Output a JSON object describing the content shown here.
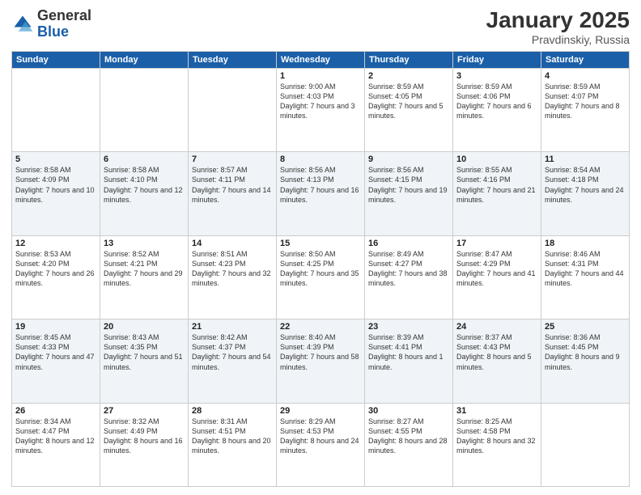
{
  "logo": {
    "general": "General",
    "blue": "Blue"
  },
  "header": {
    "title": "January 2025",
    "subtitle": "Pravdinskiy, Russia"
  },
  "weekdays": [
    "Sunday",
    "Monday",
    "Tuesday",
    "Wednesday",
    "Thursday",
    "Friday",
    "Saturday"
  ],
  "weeks": [
    [
      {
        "day": "",
        "info": ""
      },
      {
        "day": "",
        "info": ""
      },
      {
        "day": "",
        "info": ""
      },
      {
        "day": "1",
        "info": "Sunrise: 9:00 AM\nSunset: 4:03 PM\nDaylight: 7 hours\nand 3 minutes."
      },
      {
        "day": "2",
        "info": "Sunrise: 8:59 AM\nSunset: 4:05 PM\nDaylight: 7 hours\nand 5 minutes."
      },
      {
        "day": "3",
        "info": "Sunrise: 8:59 AM\nSunset: 4:06 PM\nDaylight: 7 hours\nand 6 minutes."
      },
      {
        "day": "4",
        "info": "Sunrise: 8:59 AM\nSunset: 4:07 PM\nDaylight: 7 hours\nand 8 minutes."
      }
    ],
    [
      {
        "day": "5",
        "info": "Sunrise: 8:58 AM\nSunset: 4:09 PM\nDaylight: 7 hours\nand 10 minutes."
      },
      {
        "day": "6",
        "info": "Sunrise: 8:58 AM\nSunset: 4:10 PM\nDaylight: 7 hours\nand 12 minutes."
      },
      {
        "day": "7",
        "info": "Sunrise: 8:57 AM\nSunset: 4:11 PM\nDaylight: 7 hours\nand 14 minutes."
      },
      {
        "day": "8",
        "info": "Sunrise: 8:56 AM\nSunset: 4:13 PM\nDaylight: 7 hours\nand 16 minutes."
      },
      {
        "day": "9",
        "info": "Sunrise: 8:56 AM\nSunset: 4:15 PM\nDaylight: 7 hours\nand 19 minutes."
      },
      {
        "day": "10",
        "info": "Sunrise: 8:55 AM\nSunset: 4:16 PM\nDaylight: 7 hours\nand 21 minutes."
      },
      {
        "day": "11",
        "info": "Sunrise: 8:54 AM\nSunset: 4:18 PM\nDaylight: 7 hours\nand 24 minutes."
      }
    ],
    [
      {
        "day": "12",
        "info": "Sunrise: 8:53 AM\nSunset: 4:20 PM\nDaylight: 7 hours\nand 26 minutes."
      },
      {
        "day": "13",
        "info": "Sunrise: 8:52 AM\nSunset: 4:21 PM\nDaylight: 7 hours\nand 29 minutes."
      },
      {
        "day": "14",
        "info": "Sunrise: 8:51 AM\nSunset: 4:23 PM\nDaylight: 7 hours\nand 32 minutes."
      },
      {
        "day": "15",
        "info": "Sunrise: 8:50 AM\nSunset: 4:25 PM\nDaylight: 7 hours\nand 35 minutes."
      },
      {
        "day": "16",
        "info": "Sunrise: 8:49 AM\nSunset: 4:27 PM\nDaylight: 7 hours\nand 38 minutes."
      },
      {
        "day": "17",
        "info": "Sunrise: 8:47 AM\nSunset: 4:29 PM\nDaylight: 7 hours\nand 41 minutes."
      },
      {
        "day": "18",
        "info": "Sunrise: 8:46 AM\nSunset: 4:31 PM\nDaylight: 7 hours\nand 44 minutes."
      }
    ],
    [
      {
        "day": "19",
        "info": "Sunrise: 8:45 AM\nSunset: 4:33 PM\nDaylight: 7 hours\nand 47 minutes."
      },
      {
        "day": "20",
        "info": "Sunrise: 8:43 AM\nSunset: 4:35 PM\nDaylight: 7 hours\nand 51 minutes."
      },
      {
        "day": "21",
        "info": "Sunrise: 8:42 AM\nSunset: 4:37 PM\nDaylight: 7 hours\nand 54 minutes."
      },
      {
        "day": "22",
        "info": "Sunrise: 8:40 AM\nSunset: 4:39 PM\nDaylight: 7 hours\nand 58 minutes."
      },
      {
        "day": "23",
        "info": "Sunrise: 8:39 AM\nSunset: 4:41 PM\nDaylight: 8 hours\nand 1 minute."
      },
      {
        "day": "24",
        "info": "Sunrise: 8:37 AM\nSunset: 4:43 PM\nDaylight: 8 hours\nand 5 minutes."
      },
      {
        "day": "25",
        "info": "Sunrise: 8:36 AM\nSunset: 4:45 PM\nDaylight: 8 hours\nand 9 minutes."
      }
    ],
    [
      {
        "day": "26",
        "info": "Sunrise: 8:34 AM\nSunset: 4:47 PM\nDaylight: 8 hours\nand 12 minutes."
      },
      {
        "day": "27",
        "info": "Sunrise: 8:32 AM\nSunset: 4:49 PM\nDaylight: 8 hours\nand 16 minutes."
      },
      {
        "day": "28",
        "info": "Sunrise: 8:31 AM\nSunset: 4:51 PM\nDaylight: 8 hours\nand 20 minutes."
      },
      {
        "day": "29",
        "info": "Sunrise: 8:29 AM\nSunset: 4:53 PM\nDaylight: 8 hours\nand 24 minutes."
      },
      {
        "day": "30",
        "info": "Sunrise: 8:27 AM\nSunset: 4:55 PM\nDaylight: 8 hours\nand 28 minutes."
      },
      {
        "day": "31",
        "info": "Sunrise: 8:25 AM\nSunset: 4:58 PM\nDaylight: 8 hours\nand 32 minutes."
      },
      {
        "day": "",
        "info": ""
      }
    ]
  ]
}
